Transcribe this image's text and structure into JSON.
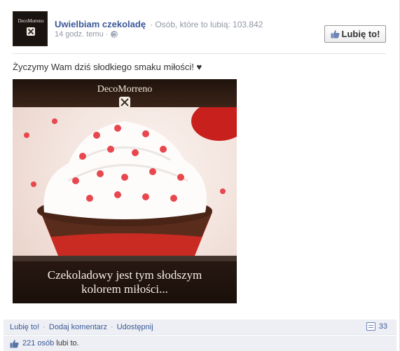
{
  "page": {
    "name": "Uwielbiam czekoladę",
    "likes_label": "· Osób, które to lubią: 103.842",
    "timestamp": "14 godz. temu ·",
    "like_button_label": "Lubię to!"
  },
  "avatar": {
    "brand_text": "DecoMorreno"
  },
  "post": {
    "text": "Życzymy Wam dziś słodkiego smaku miłości! ♥"
  },
  "photo": {
    "brand_text": "DecoMorreno",
    "caption_lines": [
      "Czekoladowy jest tym słodszym",
      "kolorem miłości..."
    ]
  },
  "actions": {
    "like": "Lubię to!",
    "separator": "·",
    "comment": "Dodaj komentarz",
    "share": "Udostępnij",
    "comment_count": "33"
  },
  "likers": {
    "count_link": "221 osób",
    "suffix": "lubi to."
  },
  "colors": {
    "link": "#3b5998",
    "muted": "#9197a3",
    "bar_background": "#edeff4"
  }
}
